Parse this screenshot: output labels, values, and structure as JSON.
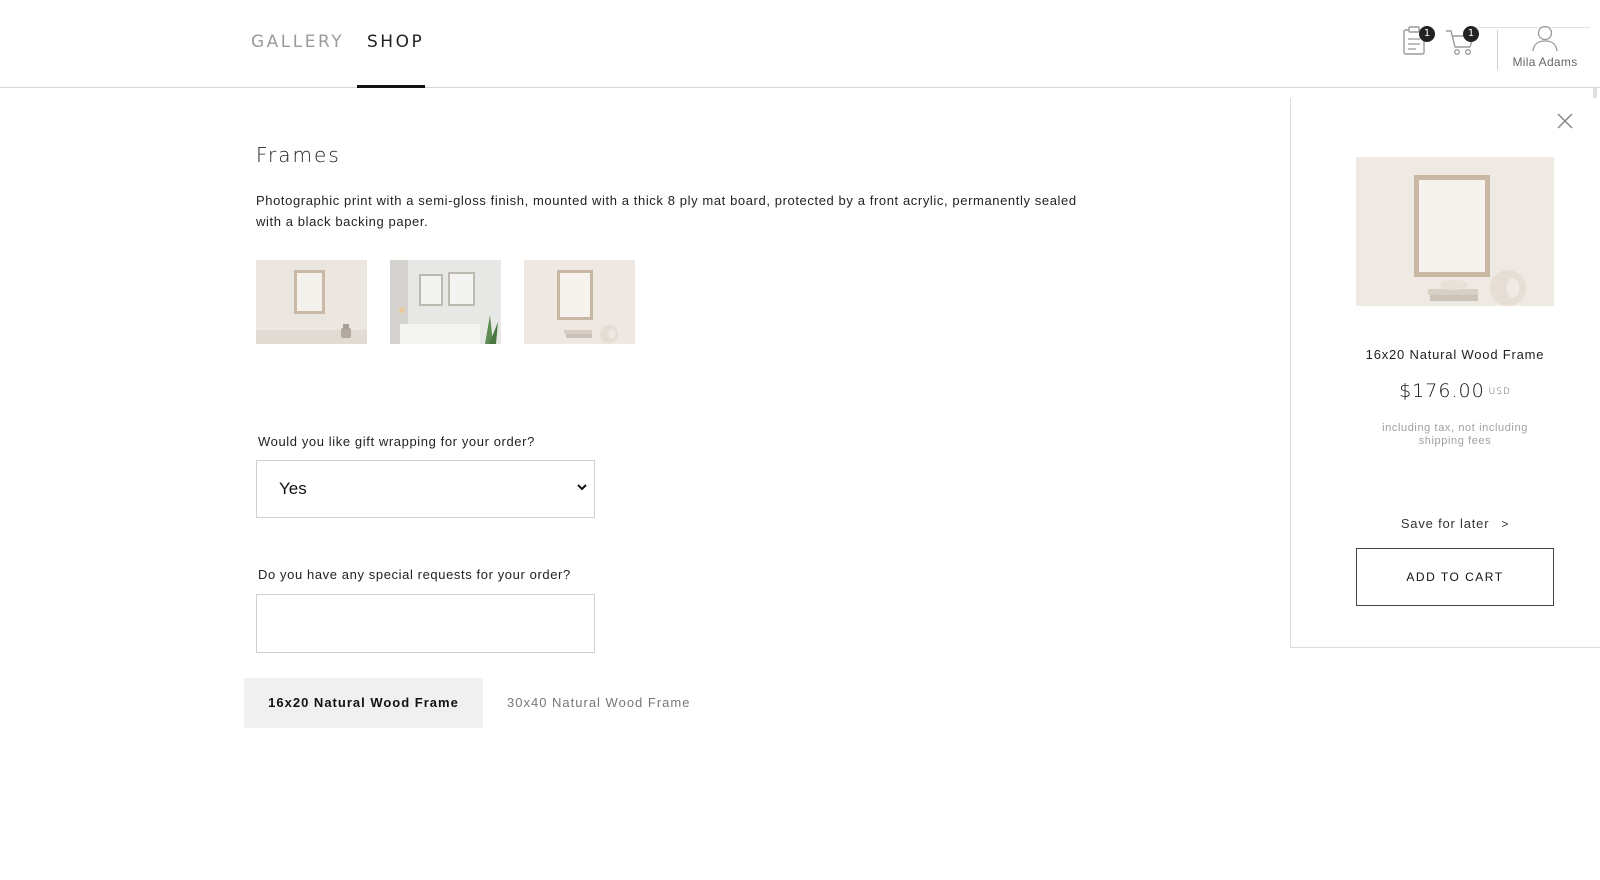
{
  "nav": {
    "tabs": [
      {
        "label": "GALLERY",
        "active": false
      },
      {
        "label": "SHOP",
        "active": true
      }
    ]
  },
  "header": {
    "orders_icon": "clipboard-icon",
    "orders_count": "1",
    "cart_icon": "cart-icon",
    "cart_count": "1",
    "user_icon": "user-icon",
    "user_name": "Mila Adams"
  },
  "product": {
    "title": "Frames",
    "description": "Photographic print with a semi-gloss finish, mounted with a thick 8 ply mat board, protected by a front acrylic, permanently sealed with a black backing paper.",
    "thumbnails": [
      "frame-thumbnail-1",
      "frame-thumbnail-2",
      "frame-thumbnail-3"
    ]
  },
  "form": {
    "gift_question": "Would you like gift wrapping for your order?",
    "gift_value": "Yes",
    "requests_question": "Do you have any special requests for your order?",
    "requests_value": ""
  },
  "variants": [
    {
      "label": "16x20 Natural Wood Frame",
      "selected": true
    },
    {
      "label": "30x40 Natural Wood Frame",
      "selected": false
    }
  ],
  "panel": {
    "close_icon": "close-icon",
    "name": "16x20 Natural Wood Frame",
    "price": "$176.00",
    "currency": "USD",
    "note": "including tax, not including shipping fees",
    "save_label": "Save for later",
    "save_arrow": ">",
    "add_to_cart": "ADD TO CART"
  },
  "colors": {
    "accent": "#111111",
    "muted": "#9b9b9b",
    "border": "#cfcfcf",
    "selected_bg": "#f0f0f0"
  }
}
